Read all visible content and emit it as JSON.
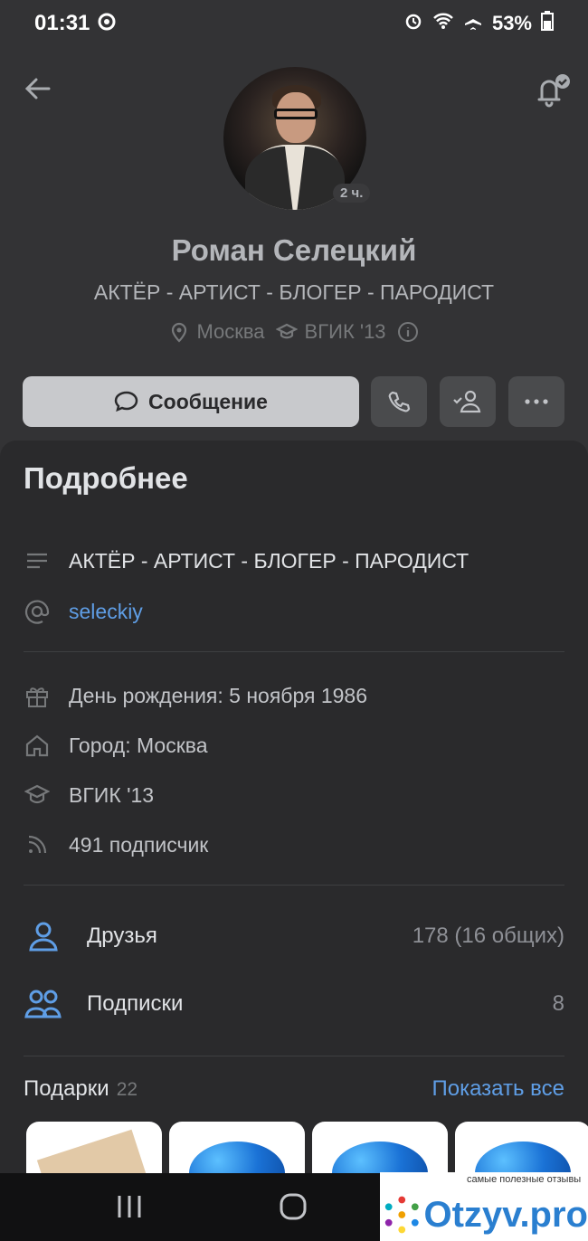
{
  "status_bar": {
    "time": "01:31",
    "battery": "53%"
  },
  "profile": {
    "online_badge": "2 ч.",
    "name": "Роман Селецкий",
    "status": "АКТЁР - АРТИСТ - БЛОГЕР - ПАРОДИСТ",
    "city": "Москва",
    "education": "ВГИК '13"
  },
  "actions": {
    "message_label": "Сообщение"
  },
  "details": {
    "title": "Подробнее",
    "about": "АКТЁР - АРТИСТ - БЛОГЕР - ПАРОДИСТ",
    "nickname": "seleckiy",
    "birthday": "День рождения: 5 ноября 1986",
    "city": "Город: Москва",
    "education": "ВГИК '13",
    "followers": "491 подписчик"
  },
  "social": {
    "friends_label": "Друзья",
    "friends_value": "178 (16 общих)",
    "subscriptions_label": "Подписки",
    "subscriptions_value": "8"
  },
  "gifts": {
    "title": "Подарки",
    "count": "22",
    "show_all": "Показать все"
  },
  "watermark": {
    "tagline": "самые полезные отзывы",
    "site": "Otzyv.pro"
  },
  "colors": {
    "accent": "#5f9ee6",
    "background": "#2a2a2c",
    "header": "#333335"
  }
}
